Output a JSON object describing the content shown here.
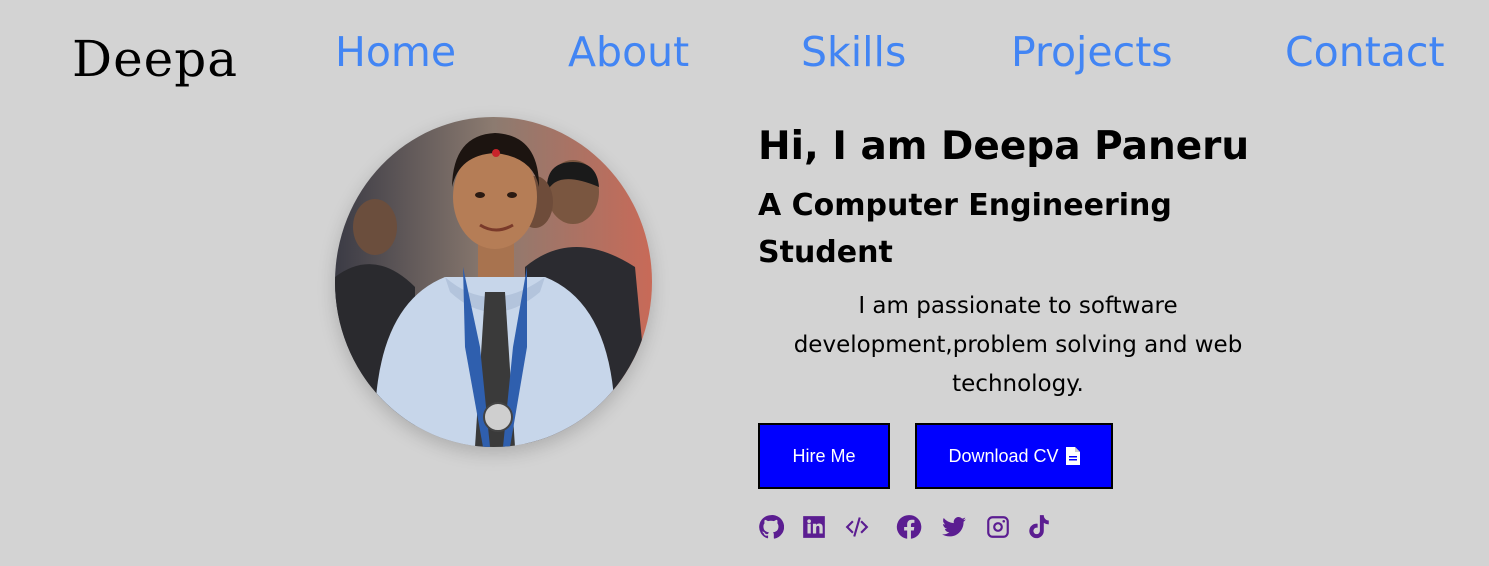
{
  "logo": "Deepa",
  "nav": [
    "Home",
    "About",
    "Skills",
    "Projects",
    "Contact"
  ],
  "hero": {
    "name": "Hi, I am Deepa Paneru",
    "role": "A Computer Engineering Student",
    "description": "I am passionate to software development,problem solving and web technology."
  },
  "buttons": {
    "hire": "Hire Me",
    "cv": "Download CV"
  },
  "socials": [
    "github-icon",
    "linkedin-icon",
    "code-icon",
    "facebook-icon",
    "twitter-icon",
    "instagram-icon",
    "tiktok-icon"
  ],
  "colors": {
    "background": "#d3d3d3",
    "nav_link": "#4285f4",
    "button": "#0000ff",
    "social_icon": "#5b1d91"
  }
}
